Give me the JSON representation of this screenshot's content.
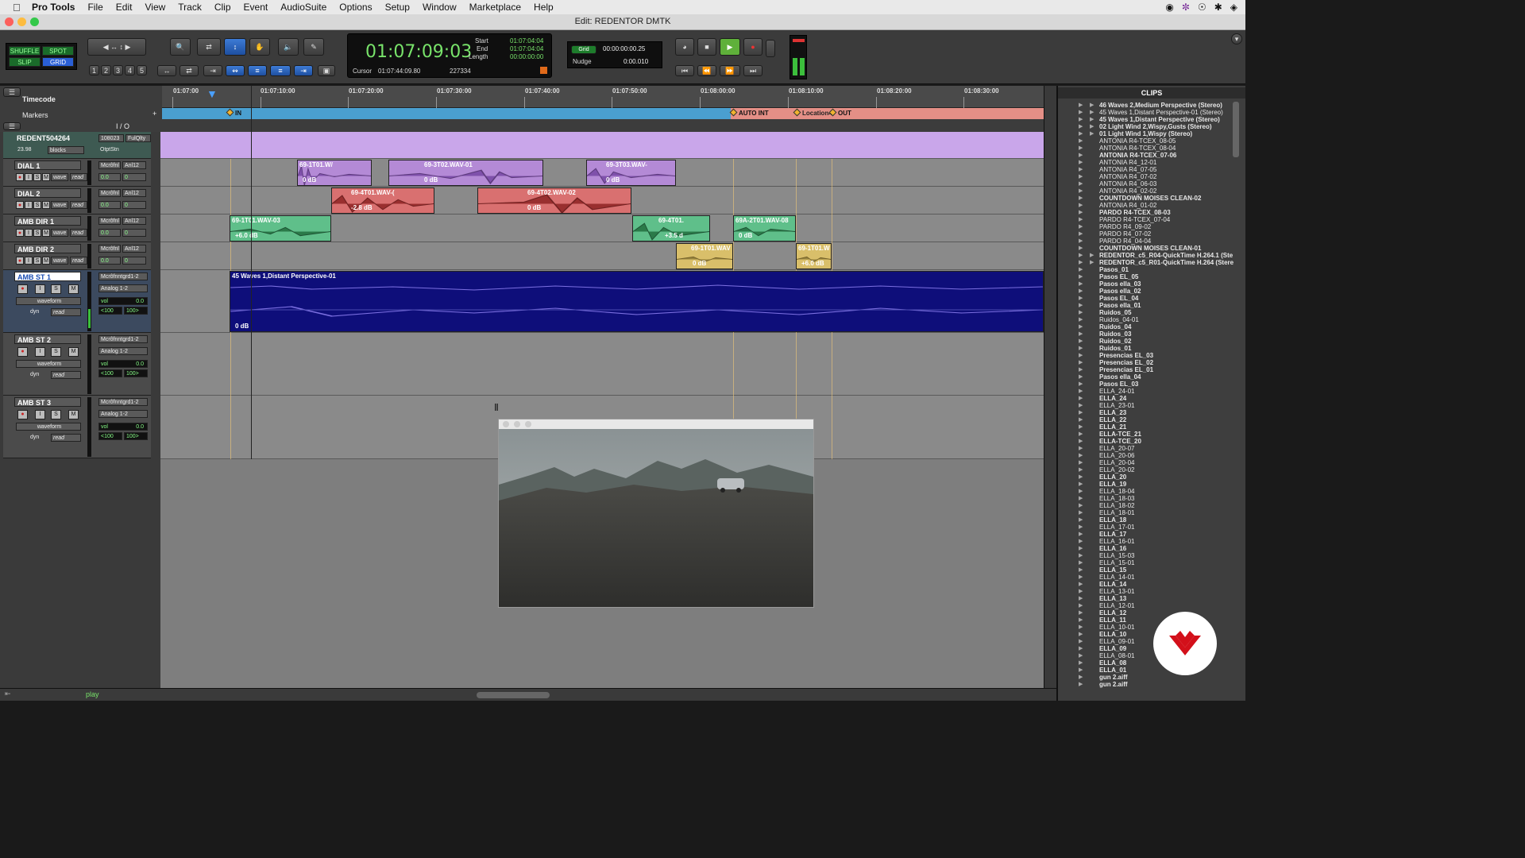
{
  "menubar": {
    "app": "Pro Tools",
    "items": [
      "File",
      "Edit",
      "View",
      "Track",
      "Clip",
      "Event",
      "AudioSuite",
      "Options",
      "Setup",
      "Window",
      "Marketplace",
      "Help"
    ]
  },
  "window": {
    "title": "Edit: REDENTOR DMTK"
  },
  "toolbar": {
    "modes": [
      "SHUFFLE",
      "SPOT",
      "SLIP",
      "GRID"
    ],
    "zoom_presets": [
      "1",
      "2",
      "3",
      "4",
      "5"
    ]
  },
  "counter": {
    "main": "01:07:09:03",
    "start_label": "Start",
    "start": "01:07:04:04",
    "end_label": "End",
    "end": "01:07:04:04",
    "length_label": "Length",
    "length": "00:00:00:00",
    "cursor_label": "Cursor",
    "cursor": "01:07:44:09.80",
    "sample": "227334"
  },
  "grid": {
    "grid_label": "Grid",
    "grid_value": "00:00:00:00.25",
    "nudge_label": "Nudge",
    "nudge_value": "0:00.010"
  },
  "rulers": {
    "timecode_label": "Timecode",
    "markers_label": "Markers",
    "io_label": "I / O",
    "ticks": [
      "01:07:00",
      "01:07:10:00",
      "01:07:20:00",
      "01:07:30:00",
      "01:07:40:00",
      "01:07:50:00",
      "01:08:00:00",
      "01:08:10:00",
      "01:08:20:00",
      "01:08:30:00"
    ],
    "markers": [
      "IN",
      "AUTO INT",
      "Location4",
      "OUT"
    ]
  },
  "tracks": [
    {
      "name": "REDENT504264",
      "io1": "108023",
      "io2": "FulQlty",
      "extra": "OtptStn",
      "fps": "23.98",
      "mode": "blocks"
    },
    {
      "name": "DIAL 1",
      "io1": "Mcrôfnl",
      "io2": "Anl12",
      "view": "wave",
      "auto": "read",
      "vol": "0.0",
      "pan": "0"
    },
    {
      "name": "DIAL 2",
      "io1": "Mcrôfnl",
      "io2": "Anl12",
      "view": "wave",
      "auto": "read",
      "vol": "0.0",
      "pan": "0"
    },
    {
      "name": "AMB DIR 1",
      "io1": "Mcrôfnl",
      "io2": "Anl12",
      "view": "wave",
      "auto": "read",
      "vol": "0.0",
      "pan": "0"
    },
    {
      "name": "AMB DIR 2",
      "io1": "Mcrôfnl",
      "io2": "Anl12",
      "view": "wave",
      "auto": "read",
      "vol": "0.0",
      "pan": "0"
    },
    {
      "name": "AMB ST 1",
      "io1": "Mcrôfnntgrd1-2",
      "io2": "Analog 1-2",
      "view": "waveform",
      "auto": "read",
      "vol_label": "vol",
      "vol": "0.0",
      "pl": "<100",
      "pr": "100>",
      "dyn": "dyn"
    },
    {
      "name": "AMB ST 2",
      "io1": "Mcrôfnntgrd1-2",
      "io2": "Analog 1-2",
      "view": "waveform",
      "auto": "read",
      "vol_label": "vol",
      "vol": "0.0",
      "pl": "<100",
      "pr": "100>",
      "dyn": "dyn"
    },
    {
      "name": "AMB ST 3",
      "io1": "Mcrôfnntgrd1-2",
      "io2": "Analog 1-2",
      "view": "waveform",
      "auto": "read",
      "vol_label": "vol",
      "vol": "0.0",
      "pl": "<100",
      "pr": "100>",
      "dyn": "dyn"
    }
  ],
  "clips": [
    {
      "name": "69-1T01.W/",
      "gain": "0 dB"
    },
    {
      "name": "69-3T02.WAV-01",
      "gain": "0 dB"
    },
    {
      "name": "69-3T03.WAV-",
      "gain": "0 dB"
    },
    {
      "name": "69-4T01.WAV-(",
      "gain": "-2.8 dB"
    },
    {
      "name": "69-4T02.WAV-02",
      "gain": "0 dB"
    },
    {
      "name": "69-1T01.WAV-03",
      "gain": "+6.0 dB"
    },
    {
      "name": "69-4T01.",
      "gain": "+3.5 d"
    },
    {
      "name": "69A-2T01.WAV-08",
      "gain": "0 dB"
    },
    {
      "name": "69-1T01.WAV",
      "gain": "0 dB"
    },
    {
      "name": "69-1T01.W",
      "gain": "+6.0 dB"
    },
    {
      "name": "45 Waves 1,Distant Perspective-01",
      "gain": "0 dB"
    }
  ],
  "clips_panel": {
    "title": "CLIPS",
    "items": [
      {
        "t": "46 Waves 2,Medium Perspective (Stereo)",
        "b": true,
        "tri": true
      },
      {
        "t": "45 Waves 1,Distant Perspective-01 (Stereo)",
        "b": false,
        "tri": true
      },
      {
        "t": "45 Waves 1,Distant Perspective (Stereo)",
        "b": true,
        "tri": true
      },
      {
        "t": "02 Light Wind 2,Wispy,Gusts (Stereo)",
        "b": true,
        "tri": true
      },
      {
        "t": "01 Light Wind 1,Wispy (Stereo)",
        "b": true,
        "tri": true
      },
      {
        "t": "ANTONIA R4-TCEX_08-05",
        "b": false
      },
      {
        "t": "ANTONIA R4-TCEX_08-04",
        "b": false
      },
      {
        "t": "ANTONIA R4-TCEX_07-06",
        "b": true
      },
      {
        "t": "ANTONIA R4_12-01",
        "b": false
      },
      {
        "t": "ANTONIA R4_07-05",
        "b": false
      },
      {
        "t": "ANTONIA R4_07-02",
        "b": false
      },
      {
        "t": "ANTONIA R4_06-03",
        "b": false
      },
      {
        "t": "ANTONIA R4_02-02",
        "b": false
      },
      {
        "t": "COUNTDOWN MOISES CLEAN-02",
        "b": true
      },
      {
        "t": "ANTONIA R4_01-02",
        "b": false
      },
      {
        "t": "PARDO R4-TCEX_08-03",
        "b": true
      },
      {
        "t": "PARDO R4-TCEX_07-04",
        "b": false
      },
      {
        "t": "PARDO R4_09-02",
        "b": false
      },
      {
        "t": "PARDO R4_07-02",
        "b": false
      },
      {
        "t": "PARDO R4_04-04",
        "b": false
      },
      {
        "t": "COUNTDOWN MOISES CLEAN-01",
        "b": true
      },
      {
        "t": "REDENTOR_c5_R04-QuickTime H.264.1 (Ste",
        "b": true,
        "tri": true
      },
      {
        "t": "REDENTOR_c5_R01-QuickTime H.264 (Stere",
        "b": true,
        "tri": true
      },
      {
        "t": "Pasos_01",
        "b": true
      },
      {
        "t": "Pasos EL_05",
        "b": true
      },
      {
        "t": "Pasos ella_03",
        "b": true
      },
      {
        "t": "Pasos ella_02",
        "b": true
      },
      {
        "t": "Pasos EL_04",
        "b": true
      },
      {
        "t": "Pasos ella_01",
        "b": true
      },
      {
        "t": "Ruidos_05",
        "b": true
      },
      {
        "t": "Ruidos_04-01",
        "b": false
      },
      {
        "t": "Ruidos_04",
        "b": true
      },
      {
        "t": "Ruidos_03",
        "b": true
      },
      {
        "t": "Ruidos_02",
        "b": true
      },
      {
        "t": "Ruidos_01",
        "b": true
      },
      {
        "t": "Presencias EL_03",
        "b": true
      },
      {
        "t": "Presencias EL_02",
        "b": true
      },
      {
        "t": "Presencias EL_01",
        "b": true
      },
      {
        "t": "Pasos ella_04",
        "b": true
      },
      {
        "t": "Pasos EL_03",
        "b": true
      },
      {
        "t": "ELLA_24-01",
        "b": false
      },
      {
        "t": "ELLA_24",
        "b": true
      },
      {
        "t": "ELLA_23-01",
        "b": false
      },
      {
        "t": "ELLA_23",
        "b": true
      },
      {
        "t": "ELLA_22",
        "b": true
      },
      {
        "t": "ELLA_21",
        "b": true
      },
      {
        "t": "ELLA-TCE_21",
        "b": true
      },
      {
        "t": "ELLA-TCE_20",
        "b": true
      },
      {
        "t": "ELLA_20-07",
        "b": false
      },
      {
        "t": "ELLA_20-06",
        "b": false
      },
      {
        "t": "ELLA_20-04",
        "b": false
      },
      {
        "t": "ELLA_20-02",
        "b": false
      },
      {
        "t": "ELLA_20",
        "b": true
      },
      {
        "t": "ELLA_19",
        "b": true
      },
      {
        "t": "ELLA_18-04",
        "b": false
      },
      {
        "t": "ELLA_18-03",
        "b": false
      },
      {
        "t": "ELLA_18-02",
        "b": false
      },
      {
        "t": "ELLA_18-01",
        "b": false
      },
      {
        "t": "ELLA_18",
        "b": true
      },
      {
        "t": "ELLA_17-01",
        "b": false
      },
      {
        "t": "ELLA_17",
        "b": true
      },
      {
        "t": "ELLA_16-01",
        "b": false
      },
      {
        "t": "ELLA_16",
        "b": true
      },
      {
        "t": "ELLA_15-03",
        "b": false
      },
      {
        "t": "ELLA_15-01",
        "b": false
      },
      {
        "t": "ELLA_15",
        "b": true
      },
      {
        "t": "ELLA_14-01",
        "b": false
      },
      {
        "t": "ELLA_14",
        "b": true
      },
      {
        "t": "ELLA_13-01",
        "b": false
      },
      {
        "t": "ELLA_13",
        "b": true
      },
      {
        "t": "ELLA_12-01",
        "b": false
      },
      {
        "t": "ELLA_12",
        "b": true
      },
      {
        "t": "ELLA_11",
        "b": true
      },
      {
        "t": "ELLA_10-01",
        "b": false
      },
      {
        "t": "ELLA_10",
        "b": true
      },
      {
        "t": "ELLA_09-01",
        "b": false
      },
      {
        "t": "ELLA_09",
        "b": true
      },
      {
        "t": "ELLA_08-01",
        "b": false
      },
      {
        "t": "ELLA_08",
        "b": true
      },
      {
        "t": "ELLA_01",
        "b": true
      },
      {
        "t": "gun 2.aiff",
        "b": true
      },
      {
        "t": "gun 2.aiff",
        "b": true
      }
    ]
  },
  "status": {
    "play": "play"
  },
  "colors": {
    "purple": "#b38be0",
    "red": "#d95a5a",
    "green": "#5fbf8a",
    "gold": "#d9bf6a",
    "navy": "#0e0e7a",
    "counter_green": "#78e36a"
  }
}
